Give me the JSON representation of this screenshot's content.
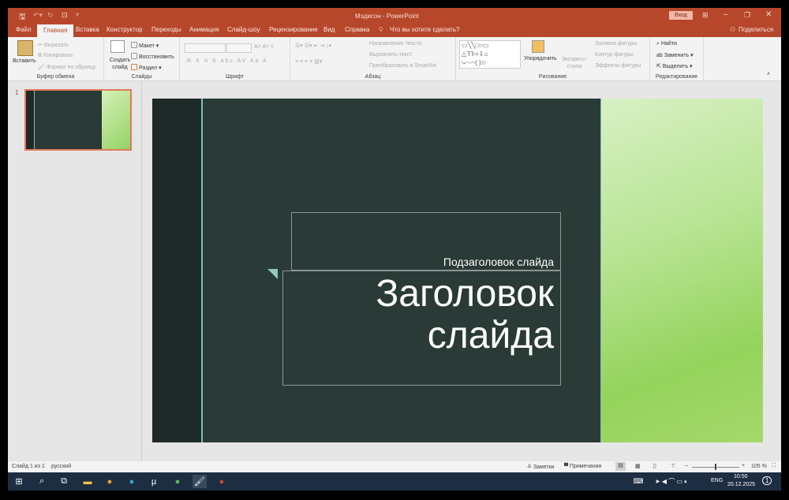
{
  "window": {
    "title": "Мэдисон  -  PowerPoint",
    "signin": "Вход"
  },
  "tabs": [
    "Файл",
    "Главная",
    "Вставка",
    "Конструктор",
    "Переходы",
    "Анимация",
    "Слайд-шоу",
    "Рецензирование",
    "Вид",
    "Справка"
  ],
  "tell_me": "Что вы хотите сделать?",
  "share": "Поделиться",
  "ribbon": {
    "clipboard": {
      "label": "Буфер обмена",
      "paste": "Вставить",
      "cut": "Вырезать",
      "copy": "Копировать",
      "format_painter": "Формат по образцу"
    },
    "slides": {
      "label": "Слайды",
      "new_slide": "Создать слайд",
      "layout": "Макет",
      "reset": "Восстановить",
      "section": "Раздел"
    },
    "font": {
      "label": "Шрифт"
    },
    "paragraph": {
      "label": "Абзац",
      "text_direction": "Направление текста",
      "align_text": "Выровнять текст",
      "smartart": "Преобразовать в SmartArt"
    },
    "drawing": {
      "label": "Рисование",
      "arrange": "Упорядочить",
      "quick_styles": "Экспресс-стили",
      "fill": "Заливка фигуры",
      "outline": "Контур фигуры",
      "effects": "Эффекты фигуры"
    },
    "editing": {
      "label": "Редактирование",
      "find": "Найти",
      "replace": "Заменить",
      "select": "Выделить"
    }
  },
  "thumbnail": {
    "number": "1"
  },
  "slide": {
    "subtitle": "Подзаголовок слайда",
    "title_line1": "Заголовок",
    "title_line2": "слайда"
  },
  "status": {
    "slide_of": "Слайд 1 из 1",
    "language": "русский",
    "notes": "Заметки",
    "comments": "Примечания",
    "zoom": "105 %"
  },
  "taskbar": {
    "lang": "ENG",
    "time": "10:50",
    "date": "20.12.2025",
    "notifications": "1"
  },
  "colors": {
    "accent": "#b7472a",
    "slide_dark": "#2a3a36",
    "slide_green": "#9fd870",
    "taskbar": "#1d2d42"
  }
}
